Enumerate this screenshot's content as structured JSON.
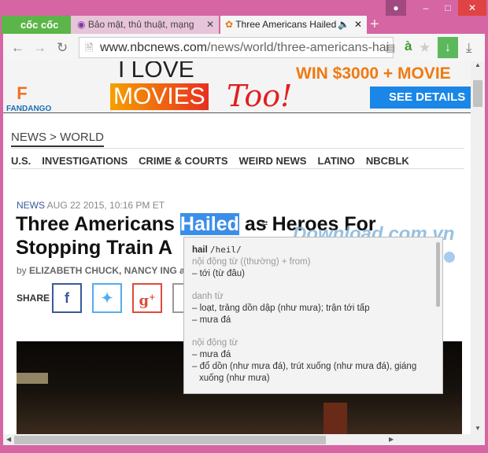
{
  "browser": {
    "logo_label": "cốc cốc",
    "tabs": [
      {
        "label": "Bảo mật, thủ thuật, mạng"
      },
      {
        "label": "Three Americans Hailed"
      }
    ],
    "url_host": "www.nbcnews.com",
    "url_path": "/news/world/three-americans-hai",
    "accent_download": "#5cb85c"
  },
  "ad": {
    "line1": "I LOVE",
    "line2": "MOVIES",
    "line3": "Too!",
    "brand": "FANDANGO",
    "promo": "WIN $3000 + MOVIE",
    "cta": "SEE DETAILS"
  },
  "breadcrumb": {
    "section": "NEWS",
    "sep": ">",
    "sub": "WORLD"
  },
  "nav": [
    "U.S.",
    "INVESTIGATIONS",
    "CRIME & COURTS",
    "WEIRD NEWS",
    "LATINO",
    "NBCBLK"
  ],
  "article": {
    "category": "NEWS",
    "date": "AUG 22 2015, 10:16 PM ET",
    "title_before": "Three Americans ",
    "title_highlight": "Hailed",
    "title_after": " as Heroes For",
    "title_line2": "Stopping Train A",
    "byline_prefix": "by",
    "authors": "ELIZABETH CHUCK, NANCY ING a",
    "share_label": "SHARE"
  },
  "watermark": "Download.com.vn",
  "dictionary": {
    "word": "hail",
    "phonetic": "/heil/",
    "entries": [
      {
        "pos": "nội động từ ((thường) + from)",
        "defs": [
          "– tới (từ đâu)"
        ]
      },
      {
        "pos": "danh từ",
        "defs": [
          "– loạt, trảng dồn dập (như mưa); trận tới tấp",
          "– mưa đá"
        ]
      },
      {
        "pos": "nội động từ",
        "defs": [
          "– mưa đá",
          "– đổ dồn (như mưa đá), trút xuống (như mưa đá), giáng xuống (như mưa)"
        ]
      }
    ]
  }
}
